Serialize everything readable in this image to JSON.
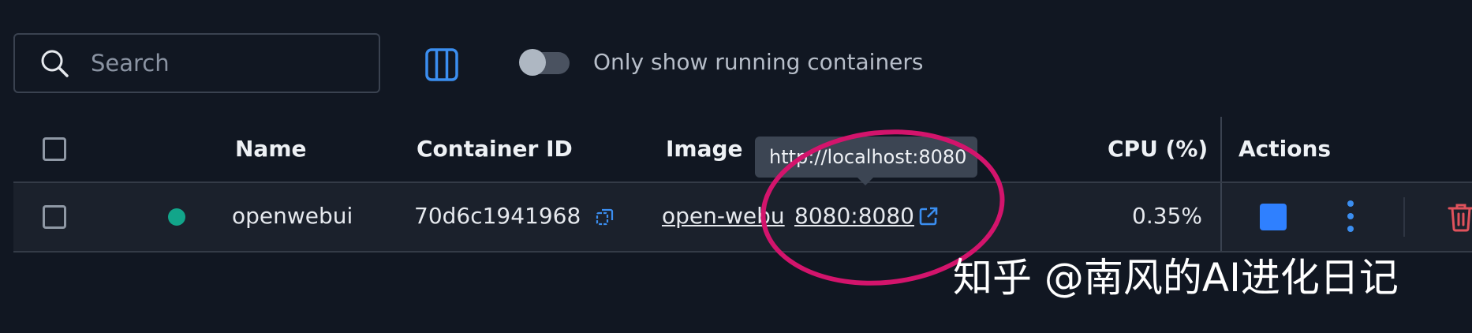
{
  "toolbar": {
    "search_placeholder": "Search",
    "toggle_label": "Only show running containers",
    "toggle_on": false
  },
  "table": {
    "columns": {
      "name": "Name",
      "container_id": "Container ID",
      "image": "Image",
      "cpu": "CPU (%)",
      "actions": "Actions"
    },
    "rows": [
      {
        "status": "running",
        "name": "openwebui",
        "container_id": "70d6c1941968",
        "image": "open-webu",
        "port": "8080:8080",
        "cpu": "0.35%"
      }
    ]
  },
  "tooltip": {
    "text": "http://localhost:8080"
  },
  "watermark": {
    "text": "知乎 @南风的AI进化日记"
  },
  "colors": {
    "background": "#111722",
    "row_background": "#1b212c",
    "accent": "#3b8ef0",
    "status_running": "#12a58a",
    "danger": "#e0525c",
    "annotation": "#d3146c"
  },
  "icons": {
    "search": "search-icon",
    "columns": "columns-icon",
    "copy": "copy-icon",
    "external_link": "external-link-icon",
    "stop": "stop-icon",
    "more": "more-vertical-icon",
    "delete": "trash-icon"
  }
}
